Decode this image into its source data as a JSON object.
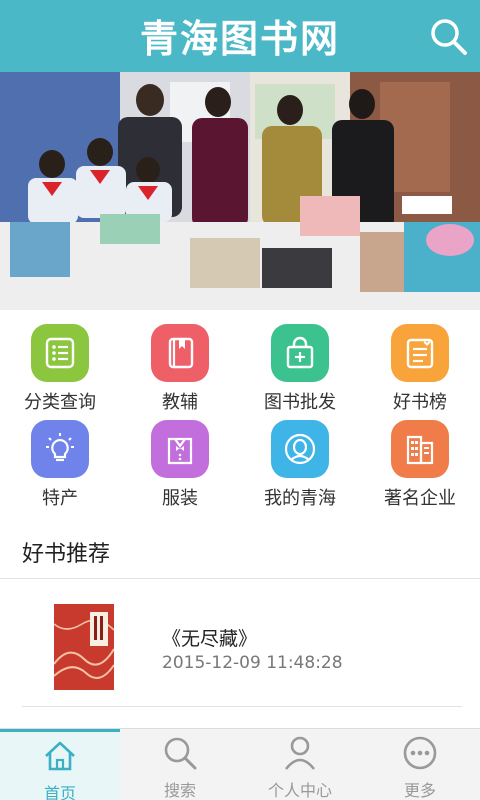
{
  "header": {
    "title": "青海图书网",
    "search_icon": "search-icon"
  },
  "colors": {
    "brand": "#4bb8c8",
    "active_tab": "#3ab0c5"
  },
  "grid": [
    {
      "label": "分类查询",
      "icon": "list-icon",
      "color": "#8cc63f"
    },
    {
      "label": "教辅",
      "icon": "book-icon",
      "color": "#ef5f67"
    },
    {
      "label": "图书批发",
      "icon": "shopping-bag-icon",
      "color": "#3bc28f"
    },
    {
      "label": "好书榜",
      "icon": "ranking-list-icon",
      "color": "#f9a33b"
    },
    {
      "label": "特产",
      "icon": "lightbulb-icon",
      "color": "#6f83ea"
    },
    {
      "label": "服装",
      "icon": "shirt-icon",
      "color": "#c26fdd"
    },
    {
      "label": "我的青海",
      "icon": "person-icon",
      "color": "#3fb4e7"
    },
    {
      "label": "著名企业",
      "icon": "building-icon",
      "color": "#f07d49"
    }
  ],
  "recommend": {
    "title": "好书推荐",
    "items": [
      {
        "name": "《无尽藏》",
        "date": "2015-12-09 11:48:28"
      }
    ]
  },
  "tabs": [
    {
      "label": "首页",
      "icon": "home-icon",
      "active": true
    },
    {
      "label": "搜索",
      "icon": "search-icon",
      "active": false
    },
    {
      "label": "个人中心",
      "icon": "user-icon",
      "active": false
    },
    {
      "label": "更多",
      "icon": "more-icon",
      "active": false
    }
  ]
}
